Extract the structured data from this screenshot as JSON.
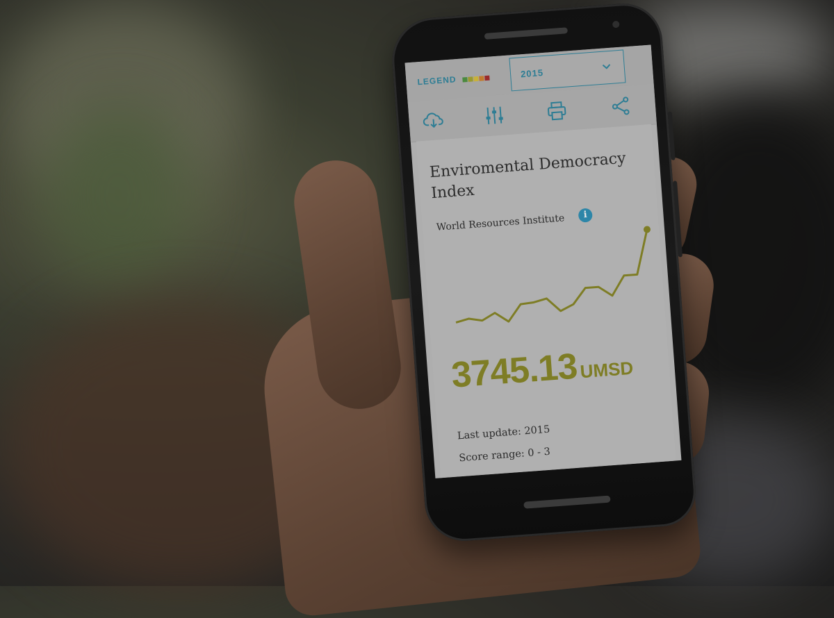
{
  "header": {
    "legend_label": "LEGEND",
    "legend_colors": [
      "#4b8a3f",
      "#9a9a2e",
      "#c9b13a",
      "#c27a2d",
      "#9a2a2a"
    ],
    "year_select": {
      "value": "2015"
    }
  },
  "toolbar": {
    "icons": [
      "cloud-download-icon",
      "sliders-icon",
      "printer-icon",
      "share-icon"
    ]
  },
  "card": {
    "title": "Enviromental Democracy Index",
    "source": "World Resources Institute",
    "value": "3745.13",
    "unit": "UMSD",
    "last_update": "Last update: 2015",
    "score_range": "Score range: 0 - 3"
  },
  "chart_data": {
    "type": "line",
    "title": "",
    "xlabel": "",
    "ylabel": "",
    "x": [
      1,
      2,
      3,
      4,
      5,
      6,
      7,
      8,
      9,
      10,
      11,
      12,
      13,
      14,
      15,
      16
    ],
    "series": [
      {
        "values": [
          1.0,
          1.15,
          1.0,
          1.35,
          0.85,
          1.7,
          1.75,
          1.9,
          1.2,
          1.5,
          2.3,
          2.3,
          1.8,
          2.8,
          2.8,
          5.1
        ]
      }
    ],
    "grid": false,
    "color": "#7e7d25"
  },
  "colors": {
    "accent": "#2d7d94",
    "value": "#7e7d25"
  }
}
